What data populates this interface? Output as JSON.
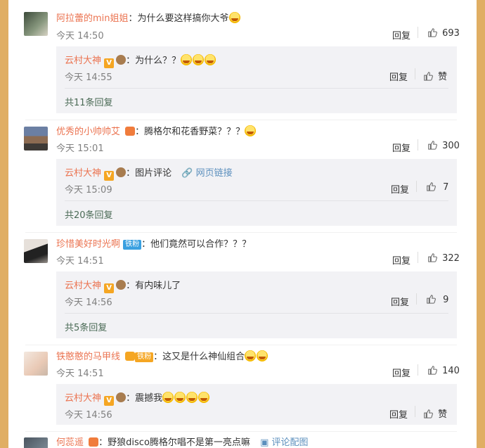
{
  "labels": {
    "reply": "回复",
    "separator": "：",
    "like": "赞"
  },
  "comments": [
    {
      "user": "阿拉蕾的min姐姐",
      "text": "为什么要这样搞你大爷",
      "time": "今天 14:50",
      "likes": "693",
      "reply": {
        "user": "云村大神",
        "text": "为什么？？",
        "time": "今天 14:55",
        "likes": "赞"
      },
      "more": "共11条回复"
    },
    {
      "user": "优秀的小帅帅艾",
      "text": "腾格尔和花香野菜？？？",
      "time": "今天 15:01",
      "likes": "300",
      "reply": {
        "user": "云村大神",
        "text": "图片评论",
        "link": "网页链接",
        "time": "今天 15:09",
        "likes": "7"
      },
      "more": "共20条回复"
    },
    {
      "user": "珍惜美好时光啊",
      "badge": "铁粉",
      "text": "他们竟然可以合作？？？",
      "time": "今天 14:51",
      "likes": "322",
      "reply": {
        "user": "云村大神",
        "text": "有内味儿了",
        "time": "今天 14:56",
        "likes": "9"
      },
      "more": "共5条回复"
    },
    {
      "user": "铁憨憨的马甲线",
      "badge": "铁粉",
      "text": "这又是什么神仙组合",
      "time": "今天 14:51",
      "likes": "140",
      "reply": {
        "user": "云村大神",
        "text": "震撼我",
        "time": "今天 14:56",
        "likes": "赞"
      }
    },
    {
      "user": "何蕊遥",
      "text": "野狼disco腾格尔唱不是第一亮点嘛",
      "link": "评论配图"
    }
  ]
}
